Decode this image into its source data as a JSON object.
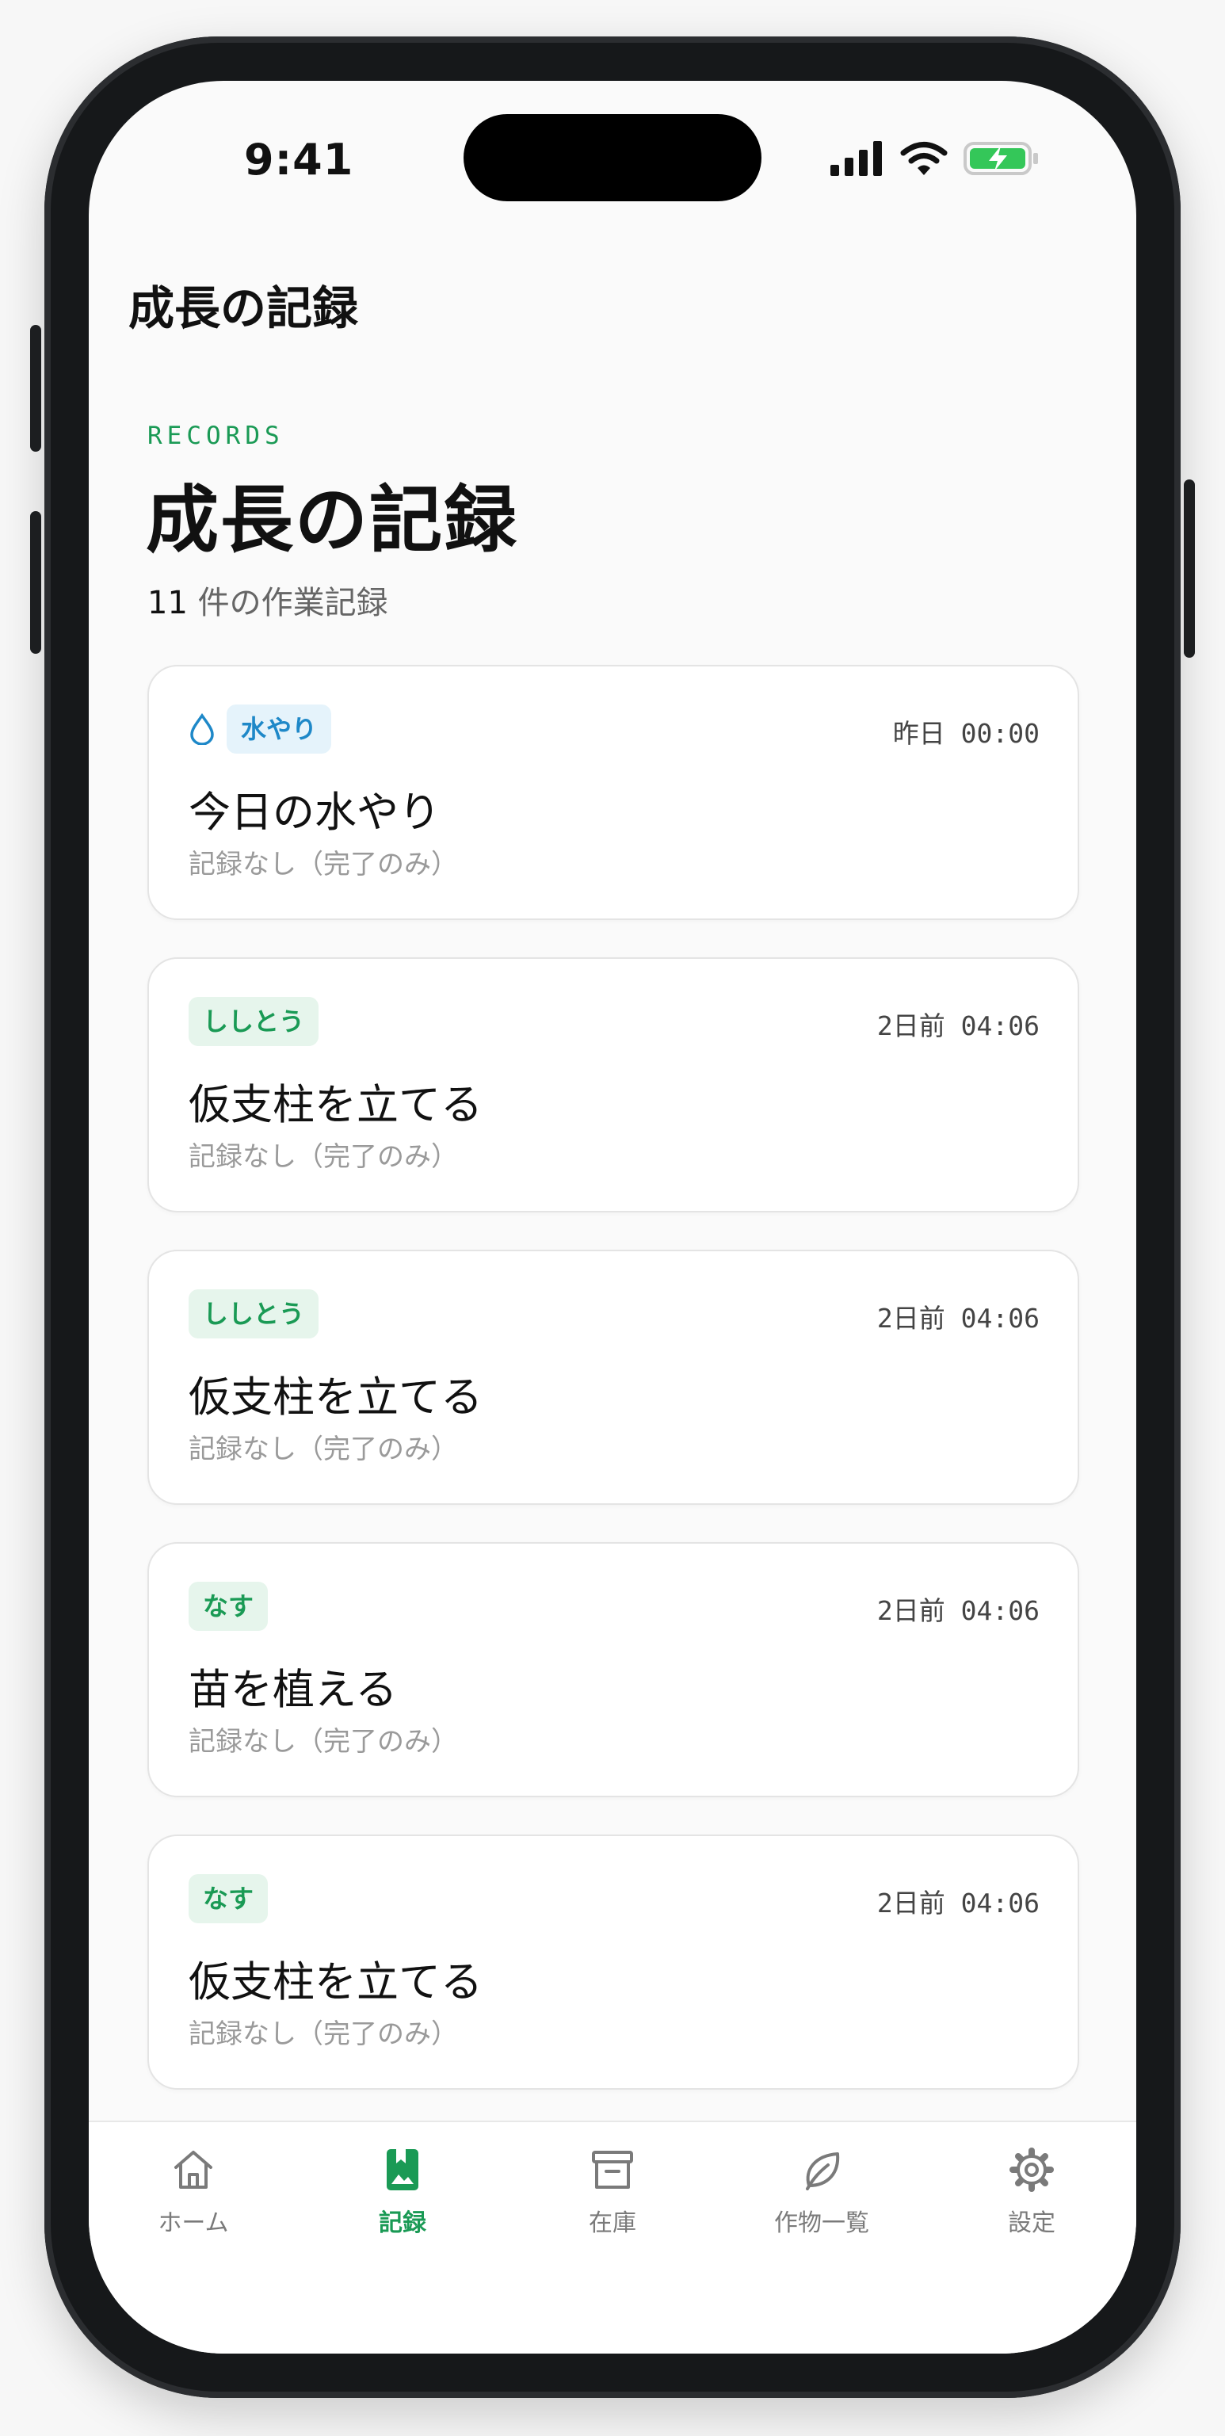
{
  "status_bar": {
    "time": "9:41"
  },
  "nav": {
    "title": "成長の記録"
  },
  "header": {
    "eyebrow": "RECORDS",
    "title": "成長の記録",
    "count": "11",
    "count_suffix": " 件の作業記録"
  },
  "records": [
    {
      "tag": "水やり",
      "tag_style": "blue",
      "icon": "water-drop-icon",
      "time": "昨日 00:00",
      "title": "今日の水やり",
      "note": "記録なし（完了のみ）"
    },
    {
      "tag": "ししとう",
      "tag_style": "green",
      "time": "2日前 04:06",
      "title": "仮支柱を立てる",
      "note": "記録なし（完了のみ）"
    },
    {
      "tag": "ししとう",
      "tag_style": "green",
      "time": "2日前 04:06",
      "title": "仮支柱を立てる",
      "note": "記録なし（完了のみ）"
    },
    {
      "tag": "なす",
      "tag_style": "green",
      "time": "2日前 04:06",
      "title": "苗を植える",
      "note": "記録なし（完了のみ）"
    },
    {
      "tag": "なす",
      "tag_style": "green",
      "time": "2日前 04:06",
      "title": "仮支柱を立てる",
      "note": "記録なし（完了のみ）"
    }
  ],
  "tabs": [
    {
      "label": "ホーム",
      "icon": "home-icon",
      "active": false
    },
    {
      "label": "記録",
      "icon": "records-icon",
      "active": true
    },
    {
      "label": "在庫",
      "icon": "archive-box-icon",
      "active": false
    },
    {
      "label": "作物一覧",
      "icon": "leaf-icon",
      "active": false
    },
    {
      "label": "設定",
      "icon": "gear-icon",
      "active": false
    }
  ],
  "colors": {
    "accent": "#1a9a55",
    "water": "#1e88c8",
    "battery": "#34c759"
  }
}
